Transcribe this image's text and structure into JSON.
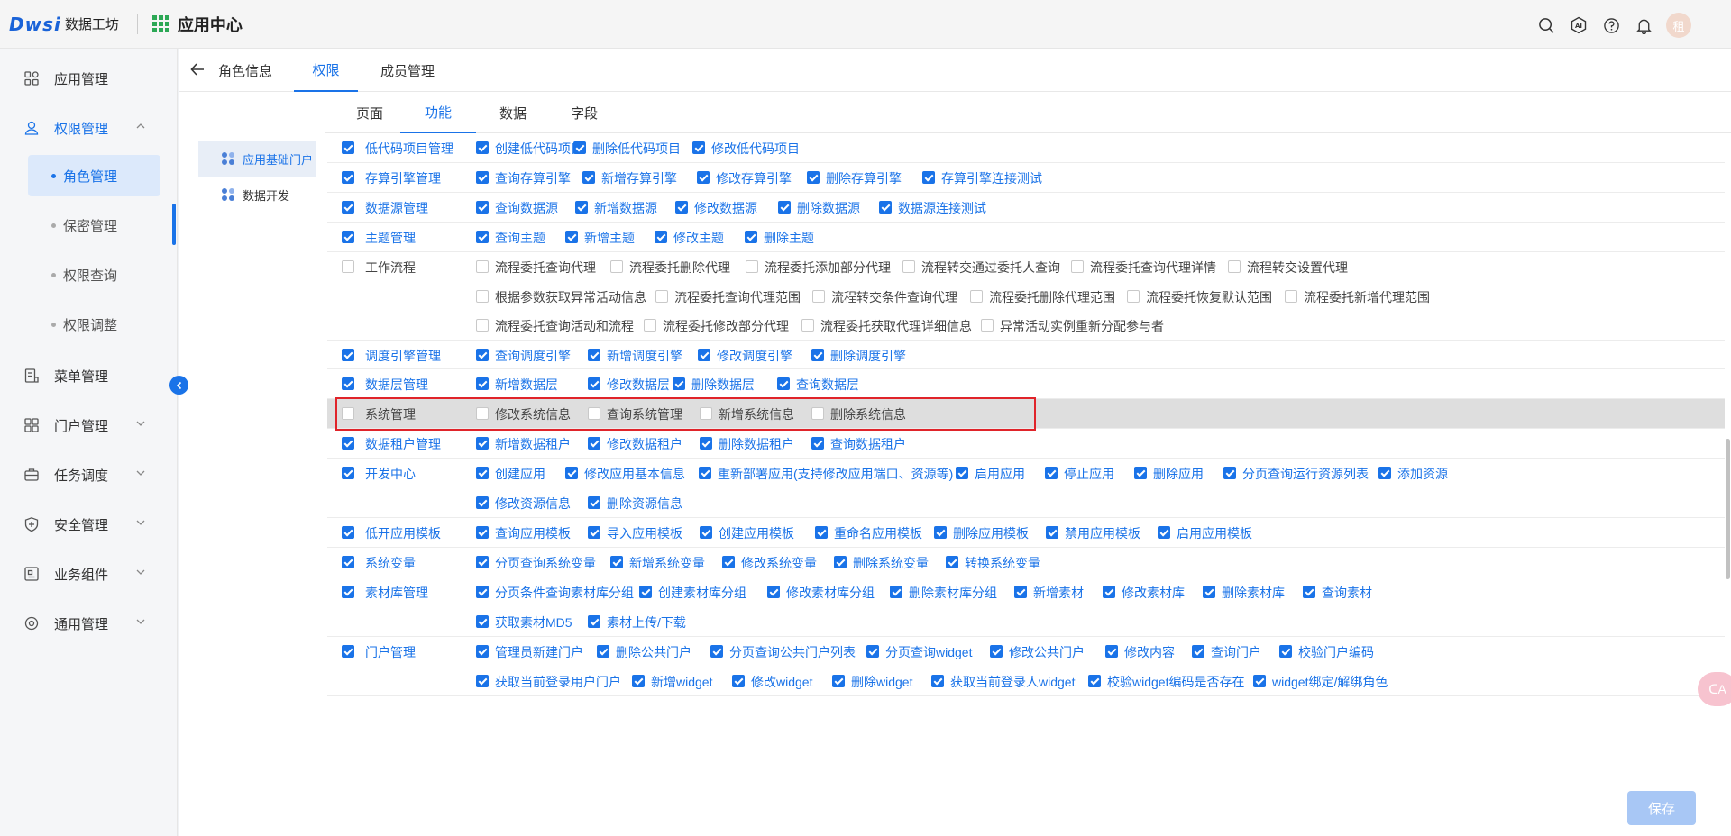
{
  "header": {
    "logo_mark": "Dws",
    "logo_mark_i": "i",
    "logo_text": "数据工坊",
    "app_title": "应用中心",
    "icons": [
      "search-icon",
      "ai-icon",
      "help-icon",
      "bell-icon"
    ],
    "avatar_text": "租"
  },
  "sidebar": {
    "items": [
      {
        "label": "应用管理",
        "icon": "app-icon"
      },
      {
        "label": "权限管理",
        "icon": "user-icon",
        "expanded": true
      },
      {
        "label": "菜单管理",
        "icon": "menu-icon"
      },
      {
        "label": "门户管理",
        "icon": "portal-icon"
      },
      {
        "label": "任务调度",
        "icon": "task-icon"
      },
      {
        "label": "安全管理",
        "icon": "shield-icon"
      },
      {
        "label": "业务组件",
        "icon": "component-icon"
      },
      {
        "label": "通用管理",
        "icon": "settings-icon"
      }
    ],
    "sub_items": [
      "角色管理",
      "保密管理",
      "权限查询",
      "权限调整"
    ],
    "active_sub": "角色管理"
  },
  "top_tabs": [
    "角色信息",
    "权限",
    "成员管理"
  ],
  "active_top_tab": "权限",
  "tree": [
    "应用基础门户",
    "数据开发"
  ],
  "sub_tabs": [
    "页面",
    "功能",
    "数据",
    "字段"
  ],
  "active_sub_tab": "功能",
  "save_label": "保存",
  "float_label": "ᑕA",
  "accent": "#1a73e8",
  "rows": [
    {
      "module": "低代码项目管理",
      "checked": true,
      "perms": [
        [
          "创建低代码项目",
          "删除低代码项目",
          "修改低代码项目"
        ]
      ]
    },
    {
      "module": "存算引擎管理",
      "checked": true,
      "perms": [
        [
          "查询存算引擎",
          "新增存算引擎",
          "修改存算引擎",
          "删除存算引擎",
          "存算引擎连接测试"
        ]
      ]
    },
    {
      "module": "数据源管理",
      "checked": true,
      "perms": [
        [
          "查询数据源",
          "新增数据源",
          "修改数据源",
          "删除数据源",
          "数据源连接测试"
        ]
      ]
    },
    {
      "module": "主题管理",
      "checked": true,
      "perms": [
        [
          "查询主题",
          "新增主题",
          "修改主题",
          "删除主题"
        ]
      ]
    },
    {
      "module": "工作流程",
      "checked": false,
      "perms": [
        [
          "流程委托查询代理",
          "流程委托删除代理",
          "流程委托添加部分代理",
          "流程转交通过委托人查询",
          "流程委托查询代理详情",
          "流程转交设置代理"
        ],
        [
          "根据参数获取异常活动信息",
          "流程委托查询代理范围",
          "流程转交条件查询代理",
          "流程委托删除代理范围",
          "流程委托恢复默认范围",
          "流程委托新增代理范围"
        ],
        [
          "流程委托查询活动和流程",
          "流程委托修改部分代理",
          "流程委托获取代理详细信息",
          "异常活动实例重新分配参与者"
        ]
      ]
    },
    {
      "module": "调度引擎管理",
      "checked": true,
      "perms": [
        [
          "查询调度引擎",
          "新增调度引擎",
          "修改调度引擎",
          "删除调度引擎"
        ]
      ]
    },
    {
      "module": "数据层管理",
      "checked": true,
      "perms": [
        [
          "新增数据层",
          "修改数据层",
          "删除数据层",
          "查询数据层"
        ]
      ]
    },
    {
      "module": "系统管理",
      "checked": false,
      "highlight": true,
      "perms": [
        [
          "修改系统信息",
          "查询系统管理",
          "新增系统信息",
          "删除系统信息"
        ]
      ]
    },
    {
      "module": "数据租户管理",
      "checked": true,
      "perms": [
        [
          "新增数据租户",
          "修改数据租户",
          "删除数据租户",
          "查询数据租户"
        ]
      ]
    },
    {
      "module": "开发中心",
      "checked": true,
      "perms": [
        [
          "创建应用",
          "修改应用基本信息",
          "重新部署应用(支持修改应用端口、资源等)",
          "启用应用",
          "停止应用",
          "删除应用",
          "分页查询运行资源列表",
          "添加资源"
        ],
        [
          "修改资源信息",
          "删除资源信息"
        ]
      ]
    },
    {
      "module": "低开应用模板",
      "checked": true,
      "perms": [
        [
          "查询应用模板",
          "导入应用模板",
          "创建应用模板",
          "重命名应用模板",
          "删除应用模板",
          "禁用应用模板",
          "启用应用模板"
        ]
      ]
    },
    {
      "module": "系统变量",
      "checked": true,
      "perms": [
        [
          "分页查询系统变量",
          "新增系统变量",
          "修改系统变量",
          "删除系统变量",
          "转换系统变量"
        ]
      ]
    },
    {
      "module": "素材库管理",
      "checked": true,
      "perms": [
        [
          "分页条件查询素材库分组",
          "创建素材库分组",
          "修改素材库分组",
          "删除素材库分组",
          "新增素材",
          "修改素材库",
          "删除素材库",
          "查询素材"
        ],
        [
          "获取素材MD5",
          "素材上传/下载"
        ]
      ]
    },
    {
      "module": "门户管理",
      "checked": true,
      "perms": [
        [
          "管理员新建门户",
          "删除公共门户",
          "分页查询公共门户列表",
          "分页查询widget",
          "修改公共门户",
          "修改内容",
          "查询门户",
          "校验门户编码"
        ],
        [
          "获取当前登录用户门户",
          "新增widget",
          "修改widget",
          "删除widget",
          "获取当前登录人widget",
          "校验widget编码是否存在",
          "widget绑定/解绑角色"
        ]
      ]
    }
  ]
}
